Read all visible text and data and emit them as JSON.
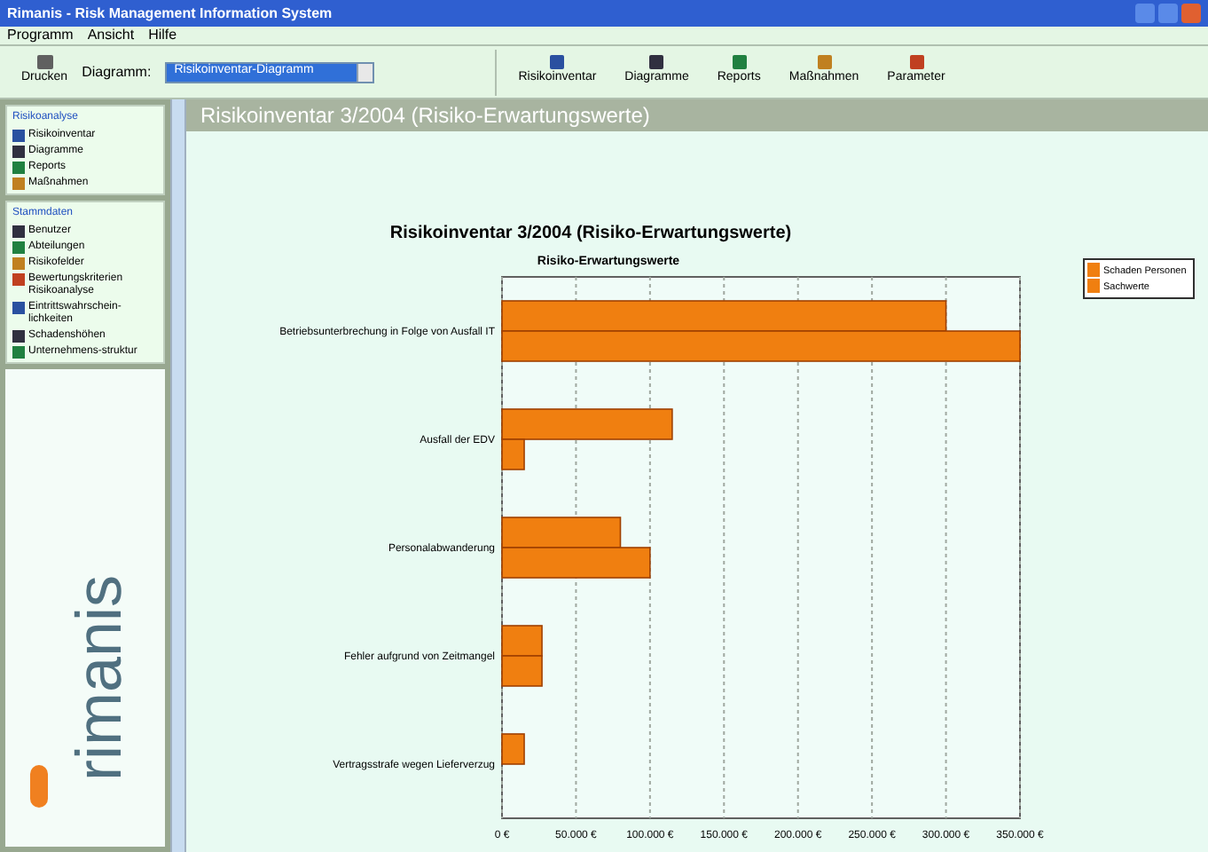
{
  "window": {
    "title": "Rimanis - Risk Management Information System"
  },
  "menu": [
    "Programm",
    "Ansicht",
    "Hilfe"
  ],
  "toolbar": {
    "print": "Drucken",
    "diagram_label": "Diagramm:",
    "diagram_value": "Risikoinventar-Diagramm",
    "buttons": [
      "Risikoinventar",
      "Diagramme",
      "Reports",
      "Maßnahmen",
      "Parameter"
    ]
  },
  "sidebar": {
    "sections": [
      {
        "title": "Risikoanalyse",
        "items": [
          "Risikoinventar",
          "Diagramme",
          "Reports",
          "Maßnahmen"
        ]
      },
      {
        "title": "Stammdaten",
        "items": [
          "Benutzer",
          "Abteilungen",
          "Risikofelder",
          "Bewertungskriterien Risikoanalyse",
          "Eintrittswahrschein-lichkeiten",
          "Schadenshöhen",
          "Unternehmens-struktur"
        ]
      }
    ]
  },
  "header": "Risikoinventar 3/2004 (Risiko-Erwartungswerte)",
  "chart_data": {
    "type": "bar",
    "orientation": "horizontal",
    "title": "Risikoinventar 3/2004 (Risiko-Erwartungswerte)",
    "subtitle": "Risiko-Erwartungswerte",
    "categories": [
      "Betriebsunterbrechung in Folge von Ausfall IT",
      "Ausfall der EDV",
      "Personalabwanderung",
      "Fehler aufgrund von Zeitmangel",
      "Vertragsstrafe wegen Lieferverzug"
    ],
    "series": [
      {
        "name": "Schaden Personen",
        "color": "#f07f10",
        "values": [
          300000,
          115000,
          80000,
          27000,
          15000
        ]
      },
      {
        "name": "Sachwerte",
        "color": "#f07f10",
        "values": [
          350000,
          15000,
          100000,
          27000,
          null
        ]
      }
    ],
    "xlim": [
      0,
      350000
    ],
    "grid": true,
    "legend": true,
    "xticks": [
      {
        "value": 0,
        "label": "0 €"
      },
      {
        "value": 50000,
        "label": "50.000 €"
      },
      {
        "value": 100000,
        "label": "100.000 €"
      },
      {
        "value": 150000,
        "label": "150.000 €"
      },
      {
        "value": 200000,
        "label": "200.000 €"
      },
      {
        "value": 250000,
        "label": "250.000 €"
      },
      {
        "value": 300000,
        "label": "300.000 €"
      },
      {
        "value": 350000,
        "label": "350.000 €"
      }
    ]
  },
  "logo": "rimanis"
}
